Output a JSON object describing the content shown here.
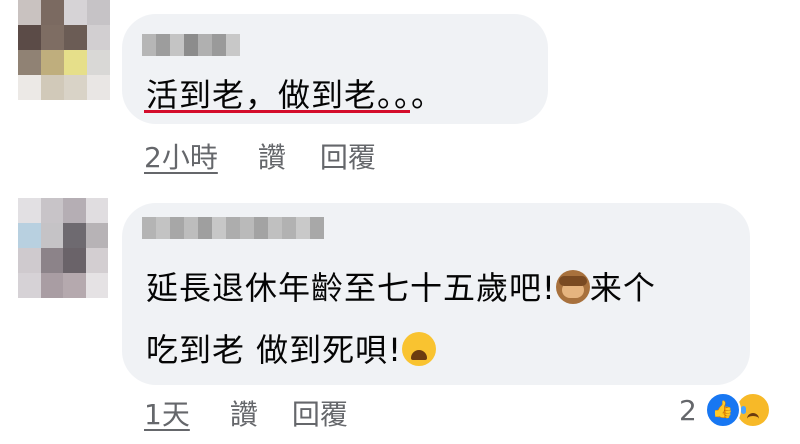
{
  "comments": [
    {
      "text_lines": [
        "活到老，做到老。。。"
      ],
      "time": "2小時",
      "like_label": "讚",
      "reply_label": "回覆",
      "avatar_colors": [
        "#c9c2c0",
        "#7b6a61",
        "#d6d3d6",
        "#c6c3c6",
        "#5b4b47",
        "#7e6d63",
        "#6b5c55",
        "#d2cfd1",
        "#908274",
        "#bfae7d",
        "#e6df8a",
        "#d9d8d6",
        "#ece9e6",
        "#d1c9b9",
        "#d9d3c7",
        "#e9e6e4"
      ],
      "name_colors": [
        "#b6b6b6",
        "#9d9d9d",
        "#c4c4c4",
        "#8c8c8c",
        "#b0b0b0",
        "#9a9a9a",
        "#c8c8c8"
      ]
    },
    {
      "text_lines": [
        "延長退休年齡至七十五歲吧!",
        "来个",
        "吃到老 做到死唄!"
      ],
      "emoji_1": "see-no-evil-monkey",
      "emoji_2": "weary-face",
      "time": "1天",
      "like_label": "讚",
      "reply_label": "回覆",
      "reaction_count": "2",
      "reactions": [
        "like",
        "sad"
      ],
      "avatar_colors": [
        "#e2e0e3",
        "#c8c4c8",
        "#b5aeb4",
        "#e0dde0",
        "#b8d0e0",
        "#c5c3c6",
        "#6e6a70",
        "#b7b3b6",
        "#cfcace",
        "#8c8389",
        "#6a6369",
        "#d3ced1",
        "#d6d2d6",
        "#a99da3",
        "#b5a9ae",
        "#e5e2e4"
      ],
      "name_colors": [
        "#b4b4b4",
        "#c3c3c3",
        "#a7a7a7",
        "#bdbdbd",
        "#9f9f9f",
        "#c7c7c7",
        "#adadad",
        "#bababa",
        "#a3a3a3",
        "#c0c0c0",
        "#b2b2b2",
        "#c9c9c9",
        "#a8a8a8"
      ]
    }
  ],
  "colors": {
    "bubble": "#f0f2f5",
    "meta_text": "#65676b",
    "underline": "#d40d2b",
    "like_blue": "#1877f2"
  }
}
